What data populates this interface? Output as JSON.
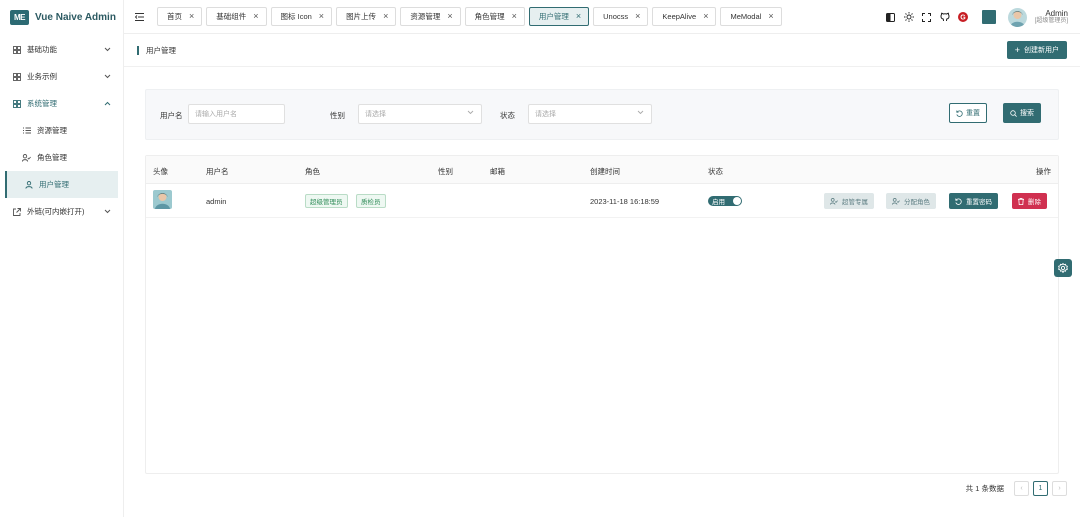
{
  "app": {
    "logo_text": "ME",
    "title": "Vue Naive Admin"
  },
  "sidebar": {
    "items": [
      {
        "label": "基础功能",
        "icon": "grid-icon"
      },
      {
        "label": "业务示例",
        "icon": "grid-icon"
      },
      {
        "label": "系统管理",
        "icon": "grid-icon"
      },
      {
        "label": "资源管理",
        "icon": "list-icon"
      },
      {
        "label": "角色管理",
        "icon": "user-check-icon"
      },
      {
        "label": "用户管理",
        "icon": "user-icon"
      },
      {
        "label": "外链(可内嵌打开)",
        "icon": "external-link-icon"
      }
    ]
  },
  "tabs": [
    {
      "label": "首页"
    },
    {
      "label": "基础组件"
    },
    {
      "label": "图标 Icon"
    },
    {
      "label": "图片上传"
    },
    {
      "label": "资源管理"
    },
    {
      "label": "角色管理"
    },
    {
      "label": "用户管理"
    },
    {
      "label": "Unocss"
    },
    {
      "label": "KeepAlive"
    },
    {
      "label": "MeModal"
    }
  ],
  "header": {
    "user_name": "Admin",
    "user_role": "[超级管理员]",
    "badge_letter": "G",
    "theme_color": "#316c72"
  },
  "page": {
    "title": "用户管理",
    "create_label": "创建新用户"
  },
  "filter": {
    "username_label": "用户名",
    "username_placeholder": "请输入用户名",
    "gender_label": "性别",
    "gender_placeholder": "请选择",
    "status_label": "状态",
    "status_placeholder": "请选择",
    "reset_label": "重置",
    "search_label": "搜索"
  },
  "table": {
    "columns": [
      "头像",
      "用户名",
      "角色",
      "性别",
      "邮箱",
      "创建时间",
      "状态",
      "操作"
    ],
    "rows": [
      {
        "username": "admin",
        "roles": [
          "超级管理员",
          "质检员"
        ],
        "gender": "",
        "email": "",
        "created_at": "2023-11-18 16:18:59",
        "status": "启用",
        "actions": [
          "超管专属",
          "分配角色",
          "重置密码",
          "删除"
        ]
      }
    ]
  },
  "pagination": {
    "total_text": "共 1 条数据",
    "page": "1",
    "prev": "‹",
    "next": "›"
  }
}
